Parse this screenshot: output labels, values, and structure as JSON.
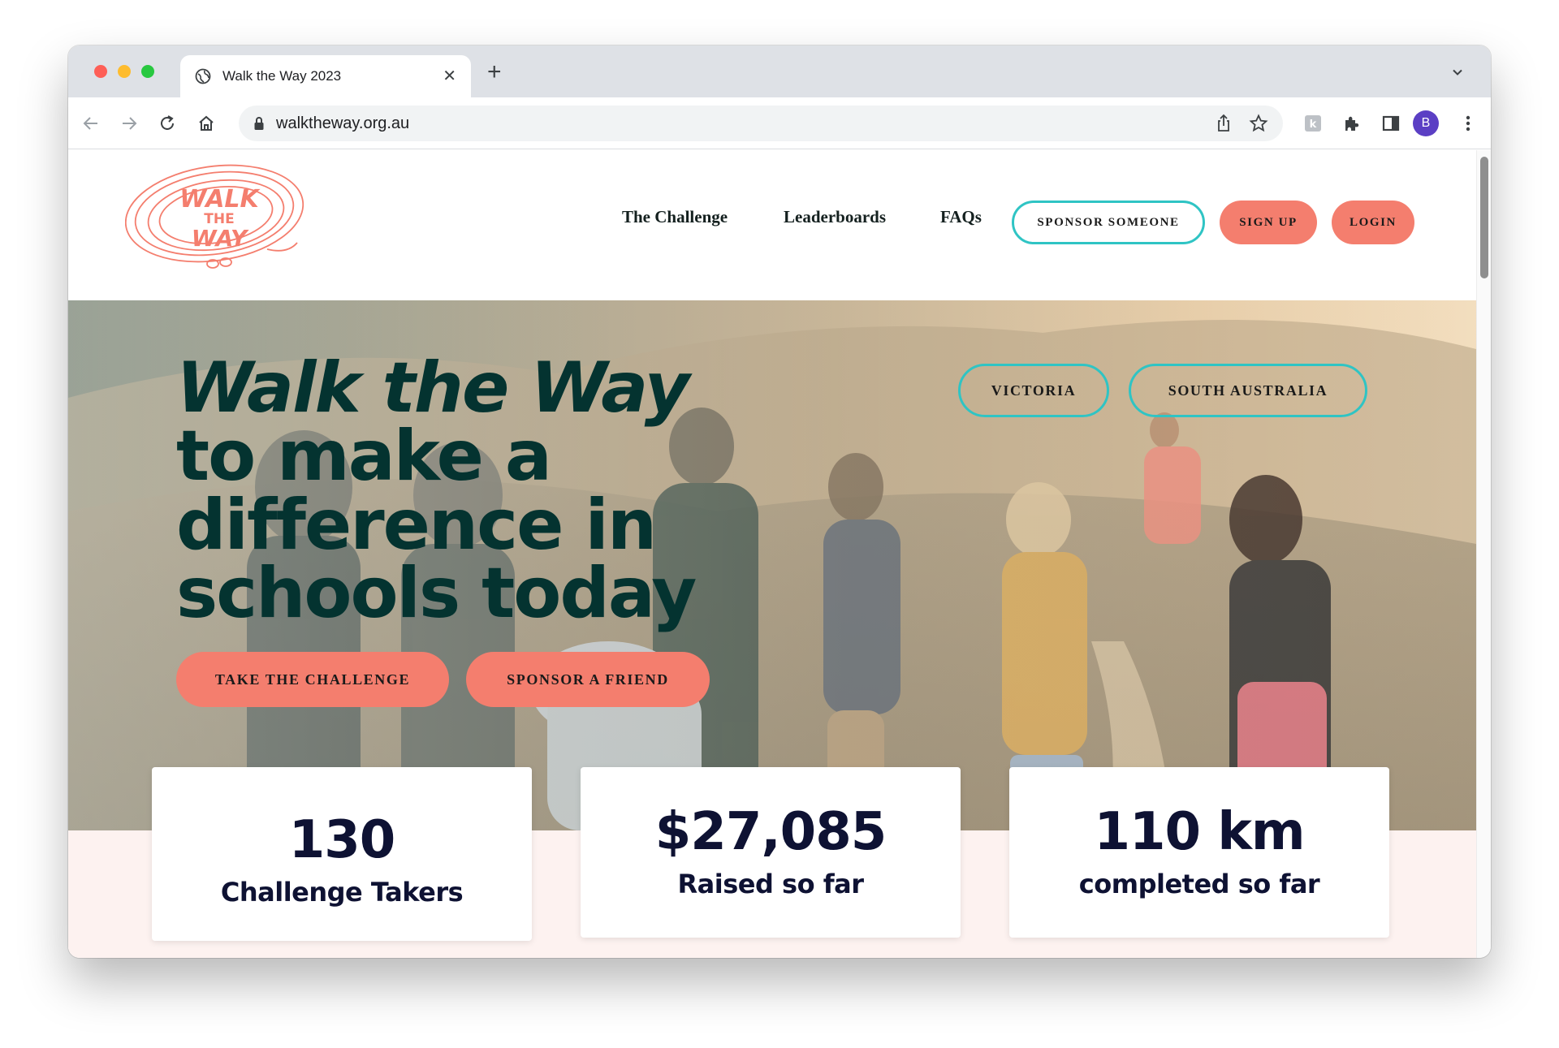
{
  "browser": {
    "tab_title": "Walk the Way 2023",
    "new_tab_label": "+",
    "url": "walktheway.org.au",
    "profile_initial": "B",
    "icons": [
      "back-icon",
      "forward-icon",
      "reload-icon",
      "home-icon",
      "lock-icon",
      "share-icon",
      "bookmark-star-icon",
      "extension-icon",
      "puzzle-icon",
      "side-panel-icon",
      "kebab-menu-icon"
    ]
  },
  "site": {
    "logo_text": [
      "WALK",
      "THE",
      "WAY"
    ],
    "nav": {
      "challenge": "The Challenge",
      "leaderboards": "Leaderboards",
      "faqs": "FAQs"
    },
    "buttons": {
      "sponsor_someone": "SPONSOR SOMEONE",
      "sign_up": "SIGN UP",
      "login": "LOGIN"
    }
  },
  "hero": {
    "headline_line1": "Walk the Way",
    "headline_line2": "to make a",
    "headline_line3": "difference in",
    "headline_line4": "schools today",
    "region_buttons": {
      "victoria": "VICTORIA",
      "south_australia": "SOUTH AUSTRALIA"
    },
    "cta": {
      "take_challenge": "TAKE THE CHALLENGE",
      "sponsor_friend": "SPONSOR A FRIEND"
    }
  },
  "stats": [
    {
      "value": "130",
      "label": "Challenge Takers"
    },
    {
      "value": "$27,085",
      "label": "Raised so far"
    },
    {
      "value": "110 km",
      "label": "completed so far"
    }
  ],
  "colors": {
    "brand_coral": "#f47e6e",
    "brand_teal": "#2fc4c4",
    "headline_green": "#043330",
    "stat_navy": "#0e1233",
    "band_pink": "#fdf2f0"
  }
}
